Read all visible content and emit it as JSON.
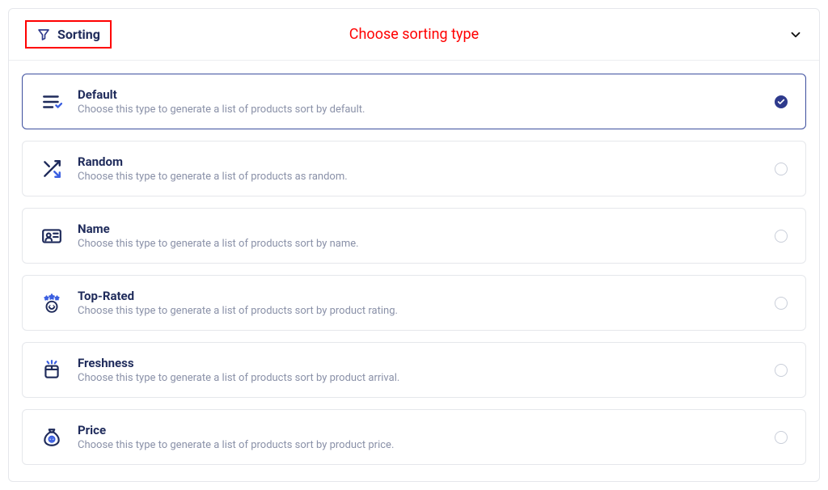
{
  "header": {
    "badge_label": "Sorting",
    "title": "Choose sorting type"
  },
  "options": [
    {
      "key": "default",
      "title": "Default",
      "desc": "Choose this type to generate a list of products sort by default.",
      "selected": true
    },
    {
      "key": "random",
      "title": "Random",
      "desc": "Choose this type to generate a list of products as random.",
      "selected": false
    },
    {
      "key": "name",
      "title": "Name",
      "desc": "Choose this type to generate a list of products sort by name.",
      "selected": false
    },
    {
      "key": "top-rated",
      "title": "Top-Rated",
      "desc": "Choose this type to generate a list of products sort by product rating.",
      "selected": false
    },
    {
      "key": "freshness",
      "title": "Freshness",
      "desc": "Choose this type to generate a list of products sort by product arrival.",
      "selected": false
    },
    {
      "key": "price",
      "title": "Price",
      "desc": "Choose this type to generate a list of products sort by product price.",
      "selected": false
    }
  ]
}
